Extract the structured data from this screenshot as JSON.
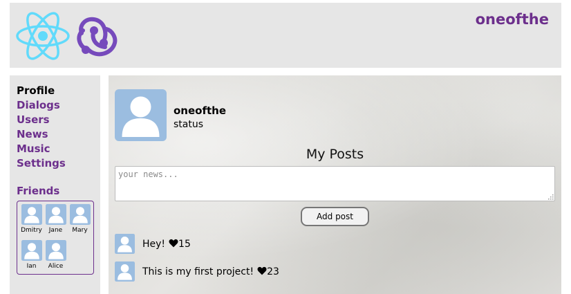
{
  "header": {
    "login_name": "oneofthe",
    "react_logo_color": "#61dafb",
    "redux_logo_color": "#764abc"
  },
  "nav": {
    "items": [
      {
        "label": "Profile",
        "active": true
      },
      {
        "label": "Dialogs"
      },
      {
        "label": "Users"
      },
      {
        "label": "News"
      },
      {
        "label": "Music"
      },
      {
        "label": "Settings"
      }
    ]
  },
  "friends": {
    "title": "Friends",
    "list": [
      {
        "name": "Dmitry"
      },
      {
        "name": "Jane"
      },
      {
        "name": "Mary"
      },
      {
        "name": "Ian"
      },
      {
        "name": "Alice"
      }
    ]
  },
  "profile": {
    "name": "oneofthe",
    "status": "status",
    "avatar_icon": "user-avatar-icon"
  },
  "posts": {
    "title": "My Posts",
    "input_placeholder": "your news...",
    "add_button": "Add post",
    "items": [
      {
        "message": "Hey!",
        "likes": "15"
      },
      {
        "message": "This is my first project!",
        "likes": "23"
      }
    ]
  },
  "colors": {
    "accent": "#6c2f8c",
    "panel": "#e6e6e6",
    "avatar_bg": "#9bbde0"
  }
}
